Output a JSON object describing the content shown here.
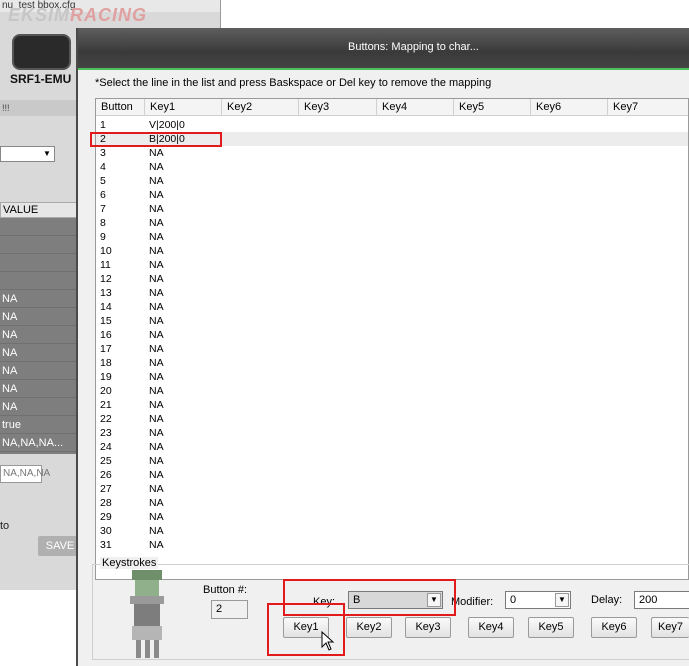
{
  "background_window": {
    "title": "nu_test bbox.cfg",
    "logo_text_left": "EKSIM",
    "logo_text_right": "RACING",
    "device_label": "SRF1-EMU",
    "bar_text": "!!!",
    "column_header": "VALUE",
    "rows": [
      "",
      "",
      "",
      "",
      "NA",
      "NA",
      "NA",
      "NA",
      "NA",
      "NA",
      "NA",
      "true",
      "NA,NA,NA..."
    ],
    "input_text": "NA,NA,NA",
    "side_text": "to",
    "save_button": "SAVE"
  },
  "dialog": {
    "title": "Buttons: Mapping to char...",
    "instruction": "*Select the line in the list and press Baskspace or Del key to remove the mapping",
    "columns": [
      "Button",
      "Key1",
      "Key2",
      "Key3",
      "Key4",
      "Key5",
      "Key6",
      "Key7"
    ],
    "rows": [
      {
        "button": "1",
        "key1": "V|200|0"
      },
      {
        "button": "2",
        "key1": "B|200|0"
      },
      {
        "button": "3",
        "key1": "NA"
      },
      {
        "button": "4",
        "key1": "NA"
      },
      {
        "button": "5",
        "key1": "NA"
      },
      {
        "button": "6",
        "key1": "NA"
      },
      {
        "button": "7",
        "key1": "NA"
      },
      {
        "button": "8",
        "key1": "NA"
      },
      {
        "button": "9",
        "key1": "NA"
      },
      {
        "button": "10",
        "key1": "NA"
      },
      {
        "button": "11",
        "key1": "NA"
      },
      {
        "button": "12",
        "key1": "NA"
      },
      {
        "button": "13",
        "key1": "NA"
      },
      {
        "button": "14",
        "key1": "NA"
      },
      {
        "button": "15",
        "key1": "NA"
      },
      {
        "button": "16",
        "key1": "NA"
      },
      {
        "button": "17",
        "key1": "NA"
      },
      {
        "button": "18",
        "key1": "NA"
      },
      {
        "button": "19",
        "key1": "NA"
      },
      {
        "button": "20",
        "key1": "NA"
      },
      {
        "button": "21",
        "key1": "NA"
      },
      {
        "button": "22",
        "key1": "NA"
      },
      {
        "button": "23",
        "key1": "NA"
      },
      {
        "button": "24",
        "key1": "NA"
      },
      {
        "button": "25",
        "key1": "NA"
      },
      {
        "button": "26",
        "key1": "NA"
      },
      {
        "button": "27",
        "key1": "NA"
      },
      {
        "button": "28",
        "key1": "NA"
      },
      {
        "button": "29",
        "key1": "NA"
      },
      {
        "button": "30",
        "key1": "NA"
      },
      {
        "button": "31",
        "key1": "NA"
      }
    ],
    "keystrokes": {
      "group_label": "Keystrokes",
      "button_number_label": "Button #:",
      "button_number_value": "2",
      "key_label": "Key:",
      "key_value": "B",
      "modifier_label": "Modifier:",
      "modifier_value": "0",
      "delay_label": "Delay:",
      "delay_value": "200",
      "key_buttons": [
        "Key1",
        "Key2",
        "Key3",
        "Key4",
        "Key5",
        "Key6",
        "Key7"
      ]
    }
  },
  "colors": {
    "highlight": "#e11b1b",
    "title_bar": "#3a3a3a",
    "accent_green": "#4ec05a"
  }
}
